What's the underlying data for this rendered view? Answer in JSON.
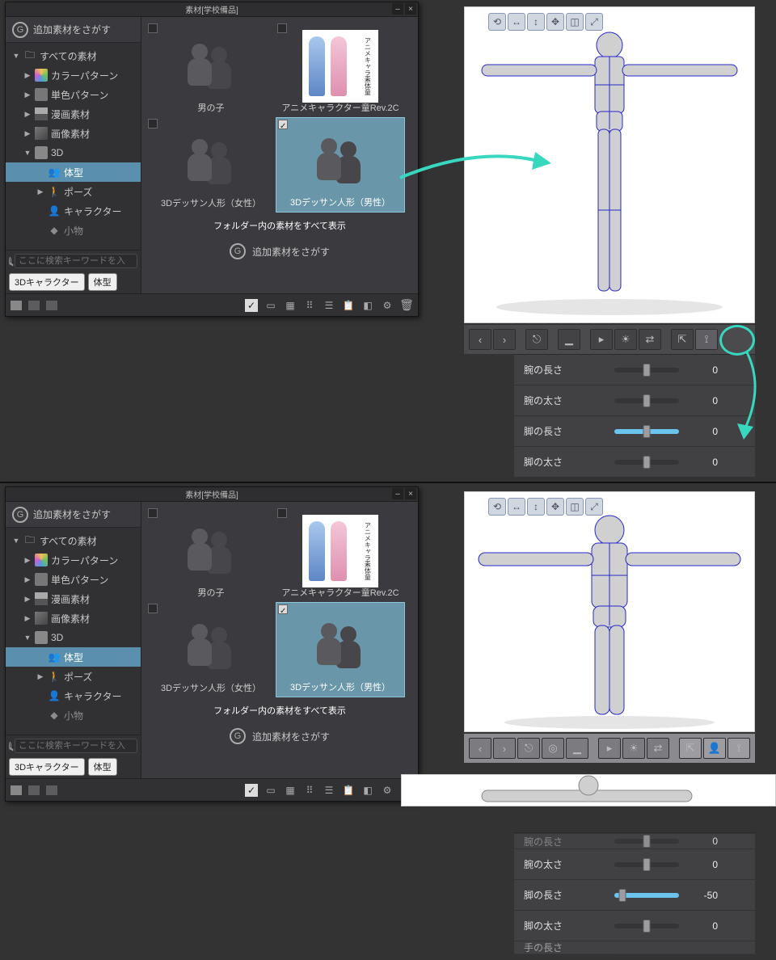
{
  "panel": {
    "title": "素材[学校備品]",
    "add_label": "追加素材をさがす",
    "tree": {
      "root": "すべての素材",
      "color_pattern": "カラーパターン",
      "mono_pattern": "単色パターン",
      "manga": "漫画素材",
      "image": "画像素材",
      "three_d": "3D",
      "body_type": "体型",
      "pose": "ポーズ",
      "character": "キャラクター",
      "props": "小物"
    },
    "search_placeholder": "ここに検索キーワードを入",
    "tags": {
      "t1": "3Dキャラクター",
      "t2": "体型"
    },
    "items": {
      "i1": "男の子",
      "i2": "アニメキャラクター童Rev.2C",
      "i3": "3Dデッサン人形（女性）",
      "i4": "3Dデッサン人形（男性）"
    },
    "anime_text": "アニメキャラ素体童",
    "anime_ver": "Rev.2C",
    "folder_all": "フォルダー内の素材をすべて表示",
    "add_more": "追加素材をさがす"
  },
  "sliders_a": {
    "r1": {
      "label": "腕の長さ",
      "value": "0",
      "fill": 50
    },
    "r2": {
      "label": "腕の太さ",
      "value": "0",
      "fill": 50
    },
    "r3": {
      "label": "脚の長さ",
      "value": "0",
      "fill": 100,
      "highlight": true
    },
    "r4": {
      "label": "脚の太さ",
      "value": "0",
      "fill": 50
    }
  },
  "sliders_b": {
    "r0": {
      "label": "腕の長さ",
      "value": "0",
      "fill": 50
    },
    "r1": {
      "label": "腕の太さ",
      "value": "0",
      "fill": 50
    },
    "r2": {
      "label": "脚の長さ",
      "value": "-50",
      "fill": 100,
      "highlight": true
    },
    "r3": {
      "label": "脚の太さ",
      "value": "0",
      "fill": 50
    },
    "r4": {
      "label": "手の長さ",
      "value": "",
      "fill": 50
    }
  }
}
